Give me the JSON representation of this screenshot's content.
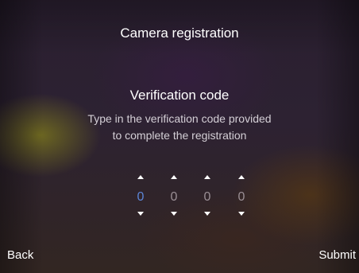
{
  "screen": {
    "title": "Camera registration",
    "heading": "Verification code",
    "description_line1": "Type in the verification code provided",
    "description_line2": "to complete the registration"
  },
  "code": {
    "digits": [
      "0",
      "0",
      "0",
      "0"
    ],
    "active_index": 0,
    "increment_icon": "caret-up-icon",
    "decrement_icon": "caret-down-icon"
  },
  "footer": {
    "back_label": "Back",
    "submit_label": "Submit"
  },
  "colors": {
    "active_digit": "#5c86d8",
    "inactive_digit": "#9a8f95",
    "text": "#ffffff"
  }
}
